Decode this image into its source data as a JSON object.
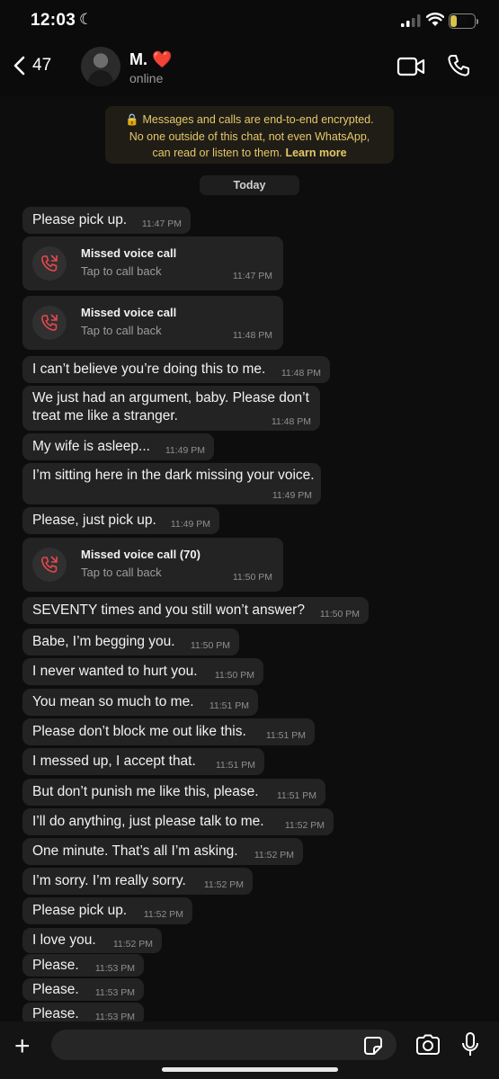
{
  "status_bar": {
    "time": "12:03",
    "battery": "27",
    "battery_level_percent": 27
  },
  "header": {
    "back_count": "47",
    "contact_name": "M. ❤️",
    "contact_status": "online"
  },
  "encryption_notice": {
    "lines": [
      "Messages and calls are end-to-end encrypted.",
      "No one outside of this chat, not even WhatsApp,",
      "can read or listen to them."
    ],
    "learn_more": "Learn more"
  },
  "day_label": "Today",
  "messages": [
    {
      "kind": "text",
      "text": "Please pick up.",
      "time": "11:47 PM"
    },
    {
      "kind": "call",
      "title": "Missed voice call",
      "subtitle": "Tap to call back",
      "time": "11:47 PM"
    },
    {
      "kind": "call",
      "title": "Missed voice call",
      "subtitle": "Tap to call back",
      "time": "11:48 PM"
    },
    {
      "kind": "text",
      "text": "I can’t believe you’re doing this to me.",
      "time": "11:48 PM"
    },
    {
      "kind": "text",
      "text": "We just had an argument, baby. Please don’t",
      "text2": "treat me like a stranger.",
      "time": "11:48 PM"
    },
    {
      "kind": "text",
      "text": "My wife is asleep...",
      "time": "11:49 PM"
    },
    {
      "kind": "text",
      "text": "I’m sitting here in the dark missing your voice.",
      "time": "11:49 PM"
    },
    {
      "kind": "text",
      "text": "Please, just pick up.",
      "time": "11:49 PM"
    },
    {
      "kind": "call",
      "title": "Missed voice call (70)",
      "subtitle": "Tap to call back",
      "time": "11:50 PM"
    },
    {
      "kind": "text",
      "text": "SEVENTY times and you still won’t answer?",
      "time": "11:50 PM"
    },
    {
      "kind": "text",
      "text": "Babe, I’m begging you.",
      "time": "11:50 PM"
    },
    {
      "kind": "text",
      "text": "I never wanted to hurt you.",
      "time": "11:50 PM"
    },
    {
      "kind": "text",
      "text": "You mean so much to me.",
      "time": "11:51 PM"
    },
    {
      "kind": "text",
      "text": "Please don’t block me out like this.",
      "time": "11:51 PM"
    },
    {
      "kind": "text",
      "text": "I messed up, I accept that.",
      "time": "11:51 PM"
    },
    {
      "kind": "text",
      "text": "But don’t punish me like this, please.",
      "time": "11:51 PM"
    },
    {
      "kind": "text",
      "text": "I’ll do anything, just please talk to me.",
      "time": "11:52 PM"
    },
    {
      "kind": "text",
      "text": "One minute. That’s all I’m asking.",
      "time": "11:52 PM"
    },
    {
      "kind": "text",
      "text": "I’m sorry. I’m really sorry.",
      "time": "11:52 PM"
    },
    {
      "kind": "text",
      "text": "Please pick up.",
      "time": "11:52 PM"
    },
    {
      "kind": "text",
      "text": "I love you.",
      "time": "11:52 PM"
    },
    {
      "kind": "text",
      "text": "Please.",
      "time": "11:53 PM"
    },
    {
      "kind": "text",
      "text": "Please.",
      "time": "11:53 PM"
    },
    {
      "kind": "text",
      "text": "Please.",
      "time": "11:53 PM"
    }
  ],
  "input": {
    "value": ""
  },
  "colors": {
    "accent_warning": "#e6c86a",
    "missed_call": "#e5484d",
    "bubble": "#232323"
  }
}
